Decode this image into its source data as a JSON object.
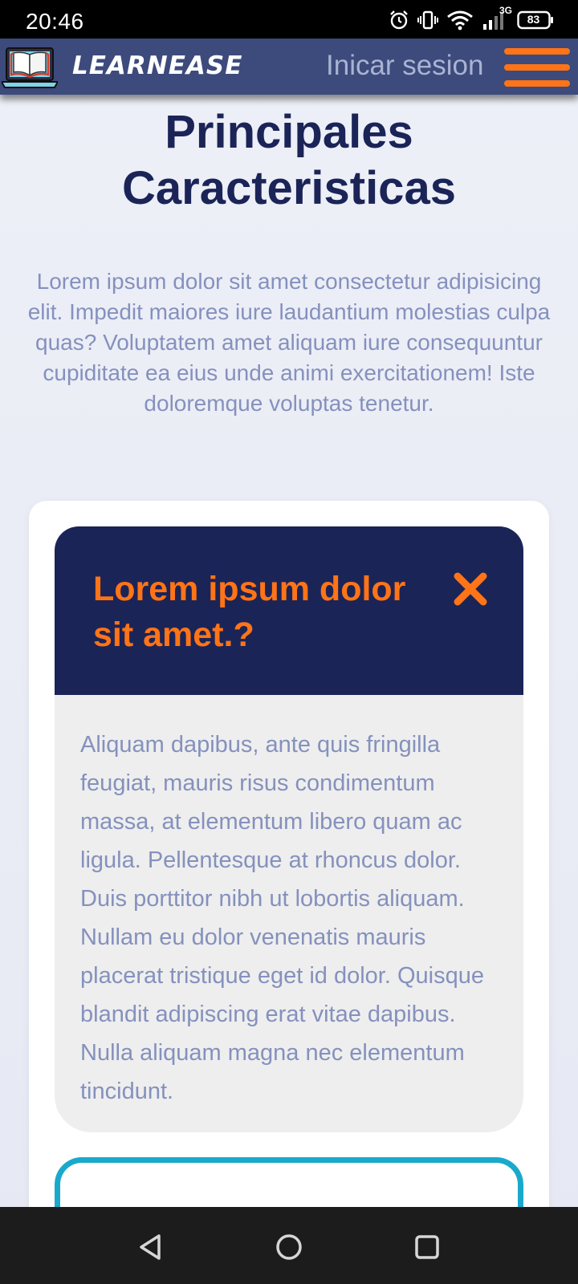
{
  "status_bar": {
    "time": "20:46",
    "network_label": "3G",
    "battery_level": "83",
    "icons": [
      "alarm-icon",
      "vibrate-icon",
      "wifi-icon",
      "signal-icon",
      "battery-icon"
    ]
  },
  "header": {
    "brand": "LEARNEASE",
    "login_label": "Inicar sesion",
    "logo_icon": "book-laptop-logo",
    "menu_icon": "hamburger-menu-icon"
  },
  "main": {
    "title": "Principales Caracteristicas",
    "intro": "Lorem ipsum dolor sit amet consectetur adipisicing elit. Impedit maiores iure laudantium molestias culpa quas? Voluptatem amet aliquam iure consequuntur cupiditate ea eius unde animi exercitationem! Iste doloremque voluptas tenetur."
  },
  "faq": {
    "items": [
      {
        "question": "Lorem ipsum dolor sit amet.?",
        "answer": "Aliquam dapibus, ante quis fringilla feugiat, mauris risus condimentum massa, at elementum libero quam ac ligula. Pellentesque at rhoncus dolor. Duis porttitor nibh ut lobortis aliquam. Nullam eu dolor venenatis mauris placerat tristique eget id dolor. Quisque blandit adipiscing erat vitae dapibus. Nulla aliquam magna nec elementum tincidunt.",
        "expanded": true
      }
    ]
  },
  "colors": {
    "header_bg": "#3d4a7c",
    "navy": "#1b2457",
    "accent_orange": "#ff7417",
    "muted_text": "#8591bd",
    "next_item_border": "#1aa9cb"
  },
  "nav_bar": {
    "icons": [
      "back-icon",
      "home-icon",
      "recents-icon"
    ]
  }
}
